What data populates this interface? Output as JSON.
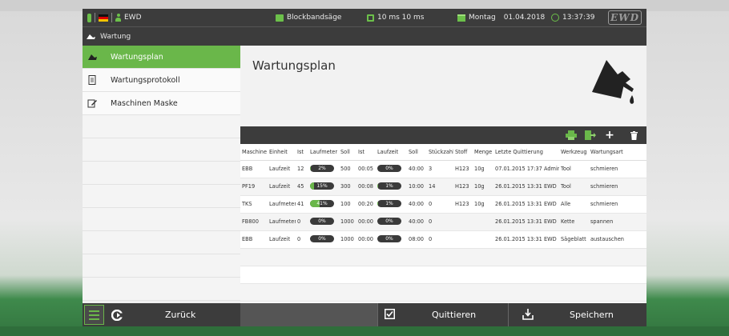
{
  "topbar": {
    "user": "EWD",
    "machine": "Blockbandsäge",
    "cycle": "10 ms  10 ms",
    "day": "Montag",
    "date": "01.04.2018",
    "time": "13:37:39",
    "logo": "EWD"
  },
  "breadcrumb": {
    "label": "Wartung"
  },
  "sidebar": {
    "items": [
      {
        "label": "Wartungsplan",
        "icon": "oilcan-icon",
        "active": true
      },
      {
        "label": "Wartungsprotokoll",
        "icon": "document-icon",
        "active": false
      },
      {
        "label": "Maschinen Maske",
        "icon": "edit-icon",
        "active": false
      }
    ]
  },
  "main": {
    "title": "Wartungsplan"
  },
  "toolbar": {
    "icons": [
      "print-icon",
      "export-icon",
      "add-icon",
      "delete-icon"
    ],
    "add_label": "+"
  },
  "table": {
    "headers": [
      "Maschine",
      "Einheit",
      "Ist",
      "Laufmeter",
      "Soll",
      "Ist",
      "Laufzeit",
      "Soll",
      "Stückzahl",
      "Stoff",
      "Menge",
      "Letzte Quittierung",
      "Werkzeug",
      "Wartungsart"
    ],
    "rows": [
      {
        "maschine": "EBB",
        "einheit": "Laufzeit",
        "ist1": "12",
        "lm_label": "2%",
        "lm_pct": 2,
        "soll1": "500",
        "ist2": "00:05",
        "lz_label": "0%",
        "lz_pct": 0,
        "soll2": "40:00",
        "stueck": "3",
        "stoff": "H123",
        "menge": "10g",
        "quitt": "07.01.2015 17:37 Admin",
        "werkzeug": "Tool",
        "art": "schmieren"
      },
      {
        "maschine": "PF19",
        "einheit": "Laufzeit",
        "ist1": "45",
        "lm_label": "15%",
        "lm_pct": 15,
        "soll1": "300",
        "ist2": "00:08",
        "lz_label": "1%",
        "lz_pct": 1,
        "soll2": "10:00",
        "stueck": "14",
        "stoff": "H123",
        "menge": "10g",
        "quitt": "26.01.2015 13:31 EWD",
        "werkzeug": "Tool",
        "art": "schmieren"
      },
      {
        "maschine": "TKS",
        "einheit": "Laufmeter",
        "ist1": "41",
        "lm_label": "41%",
        "lm_pct": 41,
        "soll1": "100",
        "ist2": "00:20",
        "lz_label": "1%",
        "lz_pct": 1,
        "soll2": "40:00",
        "stueck": "0",
        "stoff": "H123",
        "menge": "10g",
        "quitt": "26.01.2015 13:31 EWD",
        "werkzeug": "Alle",
        "art": "schmieren"
      },
      {
        "maschine": "FB800",
        "einheit": "Laufmeter",
        "ist1": "0",
        "lm_label": "0%",
        "lm_pct": 0,
        "soll1": "1000",
        "ist2": "00:00",
        "lz_label": "0%",
        "lz_pct": 0,
        "soll2": "40:00",
        "stueck": "0",
        "stoff": "",
        "menge": "",
        "quitt": "26.01.2015 13:31 EWD",
        "werkzeug": "Kette",
        "art": "spannen"
      },
      {
        "maschine": "EBB",
        "einheit": "Laufzeit",
        "ist1": "0",
        "lm_label": "0%",
        "lm_pct": 0,
        "soll1": "1000",
        "ist2": "00:00",
        "lz_label": "0%",
        "lz_pct": 0,
        "soll2": "08:00",
        "stueck": "0",
        "stoff": "",
        "menge": "",
        "quitt": "26.01.2015 13:31 EWD",
        "werkzeug": "Sägeblatt",
        "art": "austauschen"
      }
    ]
  },
  "bottombar": {
    "back_label": "Zurück",
    "quit_label": "Quittieren",
    "save_label": "Speichern"
  },
  "colors": {
    "accent": "#6ab74a",
    "dark": "#3c3c3c"
  }
}
